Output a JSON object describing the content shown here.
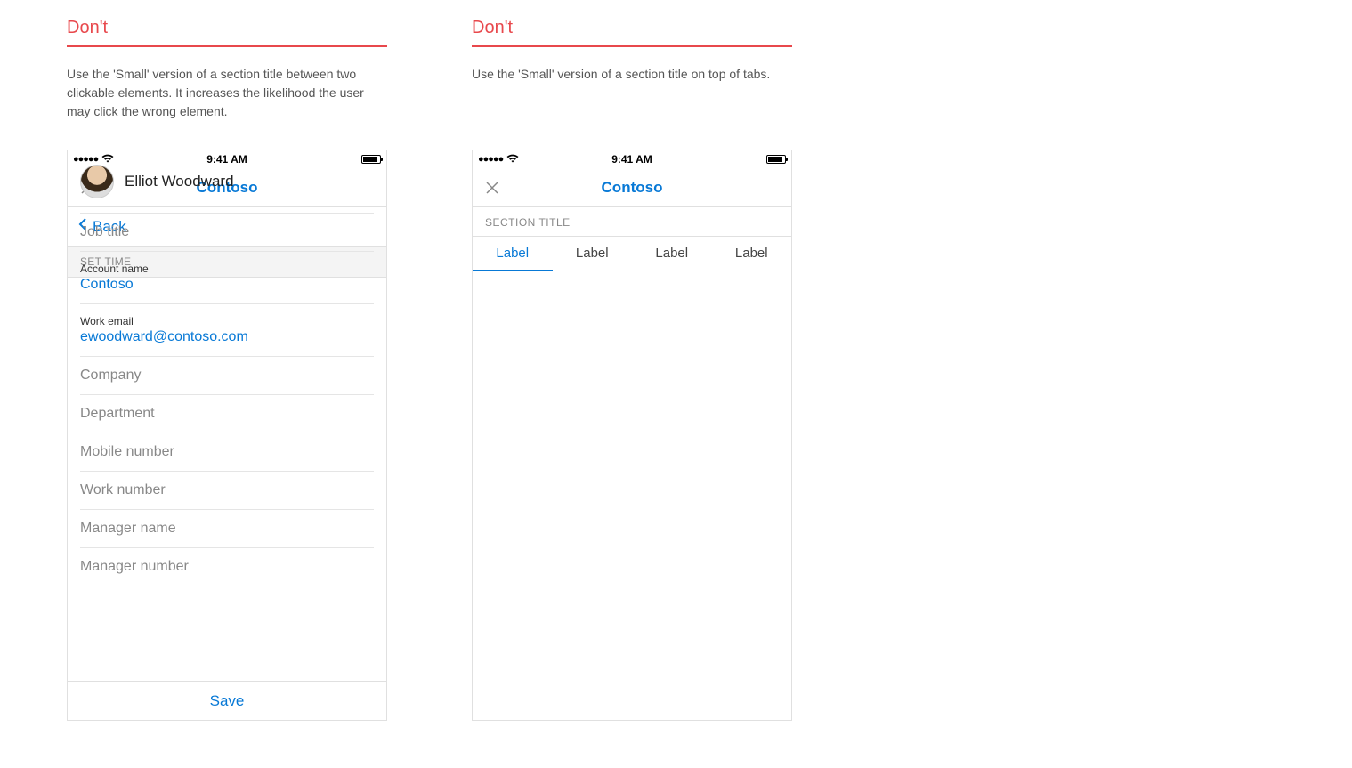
{
  "example1": {
    "heading": "Don't",
    "description": "Use the 'Small' version of a section title between two clickable elements. It increases the likelihood the user may click the wrong element.",
    "status_time": "9:41 AM",
    "nav_title": "Contoso",
    "back_label": "Back",
    "section_title": "SET TIME",
    "contact_name": "Elliot Woodward",
    "fields": {
      "job_title": "Job title",
      "account_name_label": "Account name",
      "account_name_value": "Contoso",
      "work_email_label": "Work email",
      "work_email_value": "ewoodward@contoso.com",
      "company": "Company",
      "department": "Department",
      "mobile_number": "Mobile number",
      "work_number": "Work number",
      "manager_name": "Manager name",
      "manager_number": "Manager number"
    },
    "save_label": "Save"
  },
  "example2": {
    "heading": "Don't",
    "description": "Use the 'Small' version of a section title on top of tabs.",
    "status_time": "9:41 AM",
    "nav_title": "Contoso",
    "section_title": "SECTION TITLE",
    "tabs": [
      "Label",
      "Label",
      "Label",
      "Label"
    ]
  }
}
